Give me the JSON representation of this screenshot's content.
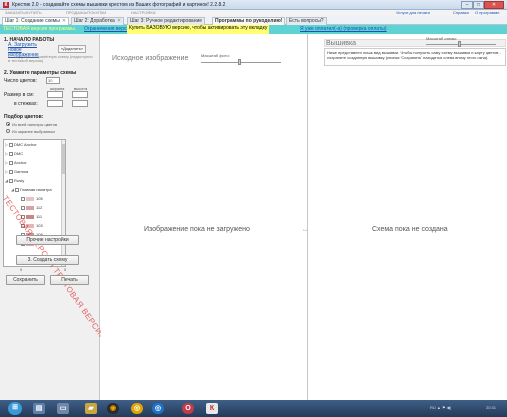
{
  "window": {
    "title": "Крестик 2.0 - создавайте схемы вышивки крестом из Ваших фотографий и картинок! 2.2.8.2",
    "buttons": {
      "min": "–",
      "max": "□",
      "close": "✕"
    }
  },
  "top_links": {
    "left1": "ЗАКАЗАТЬ/КУПИТЬ",
    "left2": "ПРОДАЖА/ПОКУПКИ",
    "left3": "НАСТРОЙКИ",
    "right1": "Услуги для печати",
    "right2": "Справка",
    "right3": "О программе"
  },
  "tabs": [
    {
      "label": "Шаг 1: Создание схемы",
      "close": "✕"
    },
    {
      "label": "Шаг 2: Доработка",
      "close": "✕"
    },
    {
      "label": "Шаг 3: Ручное редактирование",
      "close": ""
    },
    {
      "label": "Программы по рукоделию!",
      "close": ""
    },
    {
      "label": "Есть вопросы?",
      "close": ""
    }
  ],
  "banner": {
    "trial": "ТЕСТОВАЯ версия программы.",
    "limits": "Ограничения версии",
    "buy": "Купить БАЗОВУЮ версию, чтобы активировать эту вкладку",
    "how_to_pay": "Я уже оплатил(-а) (проверка оплаты)"
  },
  "left": {
    "step1_title": "1. НАЧАЛО РАБОТЫ",
    "load_image_link": "А. Загрузить новое изображение",
    "help_label": "«Доделить»",
    "load_saved": "Б. Загрузить сохранённую схему (недоступно в тестовой версии)",
    "step2_title": "2. Укажите параметры схемы",
    "colors_label": "Число цветов:",
    "colors_value": "30",
    "size_label": "Размер в см:",
    "width_label": "ширина",
    "height_label": "высота",
    "stitches_label": "в стежках:",
    "palette_title": "Подбор цветов:",
    "radio1": "Из всей палитры цветов",
    "radio2": "Из заранее выбранных",
    "tree": [
      {
        "label": "DMC Anchor",
        "arrow": "▷"
      },
      {
        "label": "DMC",
        "arrow": "▷"
      },
      {
        "label": "Anchor",
        "arrow": "▷"
      },
      {
        "label": "Gamma",
        "arrow": "▷"
      },
      {
        "label": "Rusty",
        "arrow": "◢"
      },
      {
        "label": "Главная палитра",
        "arrow": "◢"
      },
      {
        "label": "105"
      },
      {
        "label": "112"
      },
      {
        "label": "111"
      },
      {
        "label": "103"
      },
      {
        "label": "108"
      },
      {
        "label": "110"
      }
    ],
    "watermark": "ТЕСТОВАЯ ВЕРСИЯ   ТЕСТОВАЯ ВЕРСИЯ",
    "other_settings": "Прочие настройки",
    "create_scheme": "3. Создать схему",
    "counter_left": "0",
    "counter_right": "0",
    "save": "Сохранить",
    "print": "Печать"
  },
  "center": {
    "title": "Исходное изображение",
    "zoom_label": "Масштаб фото:",
    "placeholder": "Изображение пока не загружено",
    "handle": "↔"
  },
  "right": {
    "title": "Вышивка",
    "zoom_label": "Масштаб схемы:",
    "description": "Ниже представлен лишь вид вышивки. Чтобы получить саму схему вышивки и карту цветов - сохраните созданную вышивку (кнопка 'Сохранить' находится слева внизу этого окна).",
    "placeholder": "Схема пока не создана"
  },
  "taskbar": {
    "tray_text": "RU  ▲  ⚑  ◀)",
    "clock": "20:31"
  },
  "colors": {
    "banner_bg": "#5fd3d3",
    "banner_text": "#ffff70",
    "link": "#1a55b3",
    "watermark": "#dc1414",
    "taskbar": "#2b4466"
  }
}
